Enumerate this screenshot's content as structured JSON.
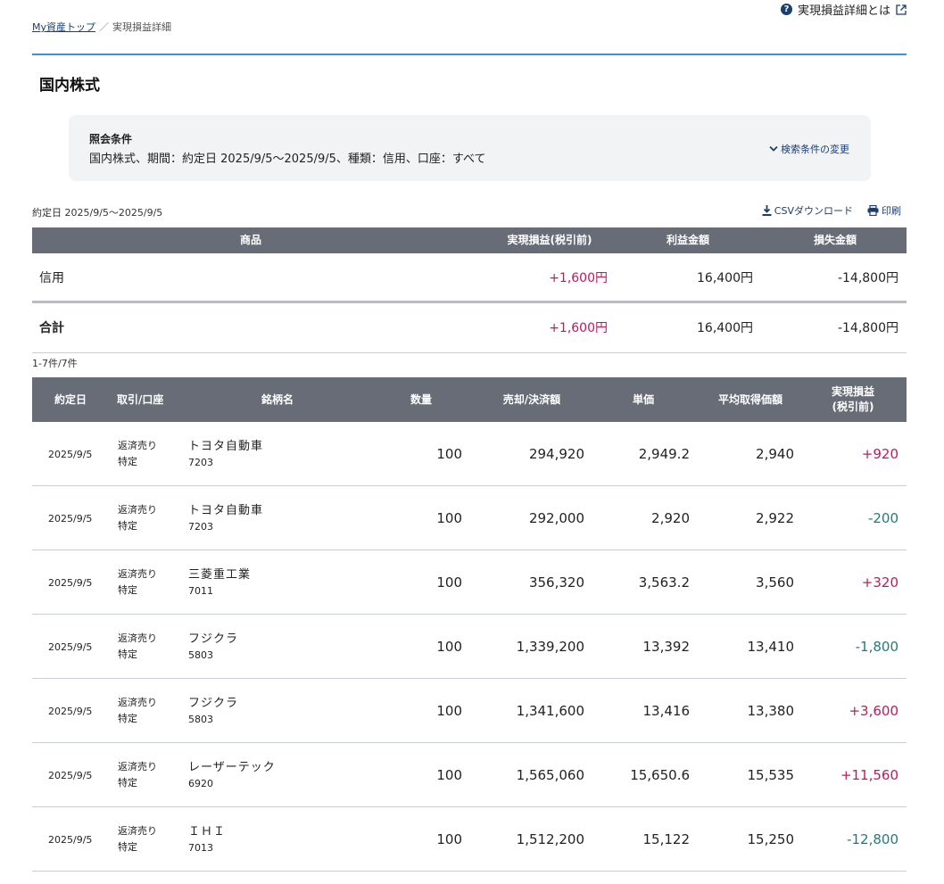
{
  "help": {
    "label": "実現損益詳細とは"
  },
  "breadcrumb": {
    "home": "My資産トップ",
    "separator": "／",
    "current": "実現損益詳細"
  },
  "section": {
    "title": "国内株式"
  },
  "conditions": {
    "label": "照会条件",
    "text": "国内株式、期間：約定日 2025/9/5〜2025/9/5、種類：信用、口座：すべて",
    "change_label": "検索条件の変更"
  },
  "period": "約定日 2025/9/5〜2025/9/5",
  "actions": {
    "csv": "CSVダウンロード",
    "print": "印刷"
  },
  "summary": {
    "headers": {
      "product": "商品",
      "realized": "実現損益(税引前)",
      "profit": "利益金額",
      "loss": "損失金額"
    },
    "rows": [
      {
        "product": "信用",
        "realized": "+1,600円",
        "profit": "16,400円",
        "loss": "-14,800円"
      }
    ],
    "total": {
      "label": "合計",
      "realized": "+1,600円",
      "profit": "16,400円",
      "loss": "-14,800円"
    }
  },
  "count": "1-7件/7件",
  "detail": {
    "headers": {
      "date": "約定日",
      "account": "取引/口座",
      "name": "銘柄名",
      "qty": "数量",
      "amount": "売却/決済額",
      "price": "単価",
      "avg": "平均取得価額",
      "realized_1": "実現損益",
      "realized_2": "(税引前)"
    },
    "rows": [
      {
        "date": "2025/9/5",
        "trade": "返済売り",
        "account": "特定",
        "name": "トヨタ自動車",
        "code": "7203",
        "qty": "100",
        "amount": "294,920",
        "price": "2,949.2",
        "avg": "2,940",
        "realized": "+920"
      },
      {
        "date": "2025/9/5",
        "trade": "返済売り",
        "account": "特定",
        "name": "トヨタ自動車",
        "code": "7203",
        "qty": "100",
        "amount": "292,000",
        "price": "2,920",
        "avg": "2,922",
        "realized": "-200"
      },
      {
        "date": "2025/9/5",
        "trade": "返済売り",
        "account": "特定",
        "name": "三菱重工業",
        "code": "7011",
        "qty": "100",
        "amount": "356,320",
        "price": "3,563.2",
        "avg": "3,560",
        "realized": "+320"
      },
      {
        "date": "2025/9/5",
        "trade": "返済売り",
        "account": "特定",
        "name": "フジクラ",
        "code": "5803",
        "qty": "100",
        "amount": "1,339,200",
        "price": "13,392",
        "avg": "13,410",
        "realized": "-1,800"
      },
      {
        "date": "2025/9/5",
        "trade": "返済売り",
        "account": "特定",
        "name": "フジクラ",
        "code": "5803",
        "qty": "100",
        "amount": "1,341,600",
        "price": "13,416",
        "avg": "13,380",
        "realized": "+3,600"
      },
      {
        "date": "2025/9/5",
        "trade": "返済売り",
        "account": "特定",
        "name": "レーザーテック",
        "code": "6920",
        "qty": "100",
        "amount": "1,565,060",
        "price": "15,650.6",
        "avg": "15,535",
        "realized": "+11,560"
      },
      {
        "date": "2025/9/5",
        "trade": "返済売り",
        "account": "特定",
        "name": "ＩＨＩ",
        "code": "7013",
        "qty": "100",
        "amount": "1,512,200",
        "price": "15,122",
        "avg": "15,250",
        "realized": "-12,800"
      }
    ]
  },
  "colors": {
    "accent": "#3a92d4",
    "link": "#1a3e72",
    "header_bg": "#676c77",
    "positive": "#c2185b",
    "negative": "#1f7c7c"
  }
}
